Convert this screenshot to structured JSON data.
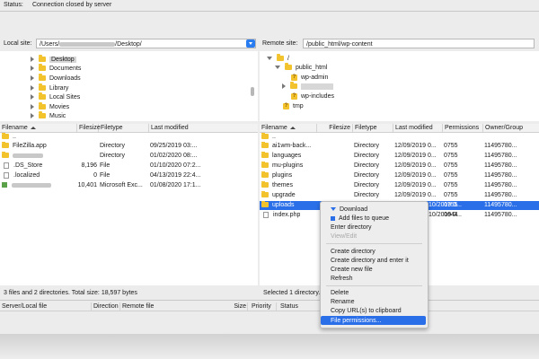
{
  "status": {
    "label": "Status:",
    "text": "Connection closed by server"
  },
  "local": {
    "label": "Local site:",
    "path_prefix": "/Users/",
    "path_suffix": "/Desktop/",
    "tree": [
      {
        "name": "Desktop",
        "highlighted": true
      },
      {
        "name": "Documents"
      },
      {
        "name": "Downloads"
      },
      {
        "name": "Library"
      },
      {
        "name": "Local Sites"
      },
      {
        "name": "Movies"
      },
      {
        "name": "Music"
      }
    ],
    "columns": [
      "Filename",
      "Filesize",
      "Filetype",
      "Last modified"
    ],
    "rows": [
      {
        "name": "..",
        "size": "",
        "type": "",
        "modified": "",
        "icon": "folder"
      },
      {
        "name": "FileZilla.app",
        "size": "",
        "type": "Directory",
        "modified": "09/25/2019 03:...",
        "icon": "folder"
      },
      {
        "name": "",
        "size": "",
        "type": "Directory",
        "modified": "01/02/2020 08:...",
        "icon": "folder",
        "redacted": true
      },
      {
        "name": ".DS_Store",
        "size": "8,196",
        "type": "File",
        "modified": "01/10/2020 07:2...",
        "icon": "file"
      },
      {
        "name": ".localized",
        "size": "0",
        "type": "File",
        "modified": "04/13/2019 22:4...",
        "icon": "file"
      },
      {
        "name": "",
        "size": "10,401",
        "type": "Microsoft Exc...",
        "modified": "01/08/2020 17:1...",
        "icon": "excel",
        "redacted": true
      }
    ],
    "footer": "3 files and 2 directories. Total size: 18,597 bytes"
  },
  "remote": {
    "label": "Remote site:",
    "path": "/public_html/wp-content",
    "tree": [
      {
        "name": "/",
        "type": "folder"
      },
      {
        "name": "public_html",
        "type": "folder"
      },
      {
        "name": "wp-admin",
        "type": "question"
      },
      {
        "name": "",
        "type": "folder",
        "highlighted": true
      },
      {
        "name": "wp-includes",
        "type": "question"
      },
      {
        "name": "tmp",
        "type": "question"
      }
    ],
    "columns": [
      "Filename",
      "Filesize",
      "Filetype",
      "Last modified",
      "Permissions",
      "Owner/Group"
    ],
    "rows": [
      {
        "name": "..",
        "type": "",
        "modified": "",
        "perms": "",
        "owner": "",
        "icon": "folder"
      },
      {
        "name": "ai1wm-back...",
        "type": "Directory",
        "modified": "12/09/2019 0...",
        "perms": "0755",
        "owner": "11495780...",
        "icon": "folder"
      },
      {
        "name": "languages",
        "type": "Directory",
        "modified": "12/09/2019 0...",
        "perms": "0755",
        "owner": "11495780...",
        "icon": "folder"
      },
      {
        "name": "mu-plugins",
        "type": "Directory",
        "modified": "12/09/2019 0...",
        "perms": "0755",
        "owner": "11495780...",
        "icon": "folder"
      },
      {
        "name": "plugins",
        "type": "Directory",
        "modified": "12/09/2019 0...",
        "perms": "0755",
        "owner": "11495780...",
        "icon": "folder"
      },
      {
        "name": "themes",
        "type": "Directory",
        "modified": "12/09/2019 0...",
        "perms": "0755",
        "owner": "11495780...",
        "icon": "folder"
      },
      {
        "name": "upgrade",
        "type": "Directory",
        "modified": "12/09/2019 0...",
        "perms": "0755",
        "owner": "11495780...",
        "icon": "folder"
      },
      {
        "name": "uploads",
        "type": "",
        "modified": "10/2019 0...",
        "perms": "0755",
        "owner": "11495780...",
        "icon": "folder",
        "selected": true
      },
      {
        "name": "index.php",
        "type": "",
        "modified": "10/2019 0...",
        "perms": "0644",
        "owner": "11495780...",
        "icon": "file"
      }
    ],
    "footer": "Selected 1 directory."
  },
  "queue": {
    "columns": [
      "Server/Local file",
      "Direction",
      "Remote file",
      "Size",
      "Priority",
      "Status"
    ]
  },
  "context_menu": {
    "items": [
      {
        "label": "Download",
        "icon": "download"
      },
      {
        "label": "Add files to queue",
        "icon": "add"
      },
      {
        "label": "Enter directory"
      },
      {
        "label": "View/Edit",
        "disabled": true
      },
      {
        "label": "Create directory"
      },
      {
        "label": "Create directory and enter it"
      },
      {
        "label": "Create new file"
      },
      {
        "label": "Refresh"
      },
      {
        "label": "Delete"
      },
      {
        "label": "Rename"
      },
      {
        "label": "Copy URL(s) to clipboard"
      },
      {
        "label": "File permissions...",
        "highlighted": true
      }
    ]
  }
}
